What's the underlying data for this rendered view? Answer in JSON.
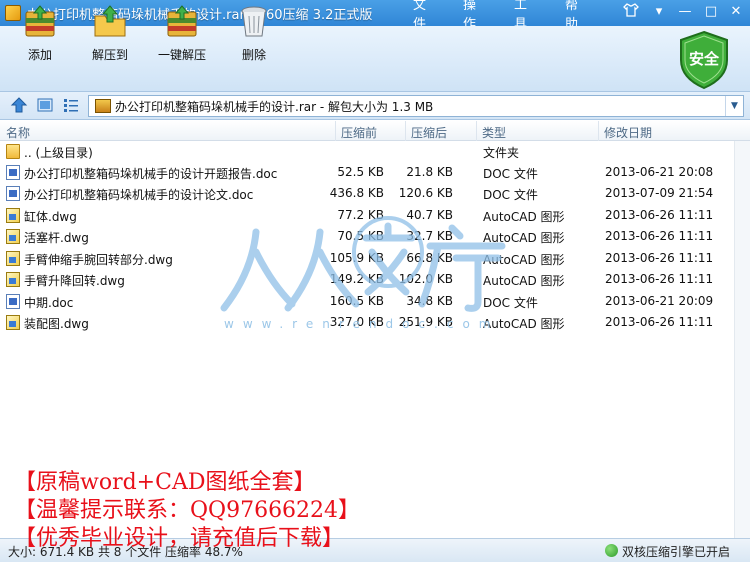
{
  "window": {
    "title": "办公打印机整箱码垛机械手的设计.rar - 360压缩 3.2正式版",
    "menu": [
      "文件",
      "操作",
      "工具",
      "帮助"
    ]
  },
  "toolbar": {
    "add_label": "添加",
    "extract_label": "解压到",
    "one_click_label": "一键解压",
    "delete_label": "删除",
    "security_label": "安全"
  },
  "address": {
    "path": "办公打印机整箱码垛机械手的设计.rar - 解包大小为 1.3 MB"
  },
  "columns": {
    "name": "名称",
    "size": "压缩前",
    "packed": "压缩后",
    "type": "类型",
    "modified": "修改日期"
  },
  "files": [
    {
      "name": ".. (上级目录)",
      "size": "",
      "packed": "",
      "type": "文件夹",
      "modified": "",
      "icon": "folder-icon"
    },
    {
      "name": "办公打印机整箱码垛机械手的设计开题报告.doc",
      "size": "52.5 KB",
      "packed": "21.8 KB",
      "type": "DOC 文件",
      "modified": "2013-06-21 20:08",
      "icon": "doc-file-icon"
    },
    {
      "name": "办公打印机整箱码垛机械手的设计论文.doc",
      "size": "436.8 KB",
      "packed": "120.6 KB",
      "type": "DOC 文件",
      "modified": "2013-07-09 21:54",
      "icon": "doc-file-icon"
    },
    {
      "name": "缸体.dwg",
      "size": "77.2 KB",
      "packed": "40.7 KB",
      "type": "AutoCAD 图形",
      "modified": "2013-06-26 11:11",
      "icon": "dwg-file-icon"
    },
    {
      "name": "活塞杆.dwg",
      "size": "70.5 KB",
      "packed": "32.7 KB",
      "type": "AutoCAD 图形",
      "modified": "2013-06-26 11:11",
      "icon": "dwg-file-icon"
    },
    {
      "name": "手臂伸缩手腕回转部分.dwg",
      "size": "105.9 KB",
      "packed": "66.8 KB",
      "type": "AutoCAD 图形",
      "modified": "2013-06-26 11:11",
      "icon": "dwg-file-icon"
    },
    {
      "name": "手臂升降回转.dwg",
      "size": "149.2 KB",
      "packed": "102.0 KB",
      "type": "AutoCAD 图形",
      "modified": "2013-06-26 11:11",
      "icon": "dwg-file-icon"
    },
    {
      "name": "中期.doc",
      "size": "160.5 KB",
      "packed": "34.8 KB",
      "type": "DOC 文件",
      "modified": "2013-06-21 20:09",
      "icon": "doc-file-icon"
    },
    {
      "name": "装配图.dwg",
      "size": "327.0 KB",
      "packed": "251.9 KB",
      "type": "AutoCAD 图形",
      "modified": "2013-06-26 11:11",
      "icon": "dwg-file-icon"
    }
  ],
  "watermark": {
    "url_text": "www.renrendoc.com"
  },
  "status": {
    "summary": "大小: 671.4 KB 共 8 个文件 压缩率 48.7%",
    "engine": "双核压缩引擎已开启"
  },
  "overlay": {
    "line1": "【原稿word+CAD图纸全套】",
    "line2": "【温馨提示联系：QQ97666224】",
    "line3": "【优秀毕业设计，请充值后下载】"
  }
}
